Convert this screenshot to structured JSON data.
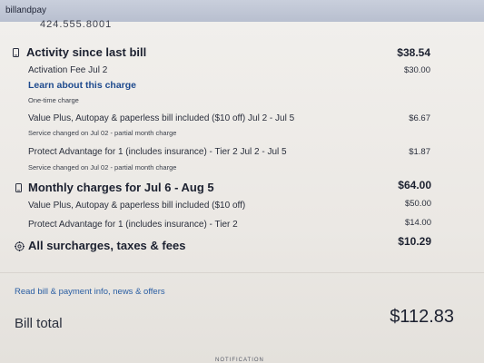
{
  "browser": {
    "tab_title": "billandpay"
  },
  "header": {
    "phone_partial": "424.555.8001"
  },
  "activity": {
    "title": "Activity since last bill",
    "total": "$38.54",
    "items": [
      {
        "label": "Activation Fee Jul 2",
        "amount": "$30.00",
        "link": "Learn about this charge",
        "note": "One-time charge"
      },
      {
        "label": "Value Plus, Autopay & paperless bill included ($10 off) Jul 2 - Jul 5",
        "amount": "$6.67",
        "note": "Service changed on Jul 02 - partial month charge"
      },
      {
        "label": "Protect Advantage for 1 (includes insurance) - Tier 2 Jul 2 - Jul 5",
        "amount": "$1.87",
        "note": "Service changed on Jul 02 - partial month charge"
      }
    ]
  },
  "monthly": {
    "title": "Monthly charges for Jul 6 - Aug 5",
    "total": "$64.00",
    "items": [
      {
        "label": "Value Plus, Autopay & paperless bill included ($10 off)",
        "amount": "$50.00"
      },
      {
        "label": "Protect Advantage for 1 (includes insurance) - Tier 2",
        "amount": "$14.00"
      }
    ]
  },
  "surcharges": {
    "title": "All surcharges, taxes & fees",
    "total": "$10.29"
  },
  "info_link": "Read bill & payment info, news & offers",
  "bill_total": {
    "label": "Bill total",
    "amount": "$112.83"
  },
  "footer": {
    "caption": "NOTIFICATION"
  },
  "icons": {
    "activity": "phone-icon",
    "monthly": "phone-icon",
    "surcharges": "gear-icon"
  }
}
